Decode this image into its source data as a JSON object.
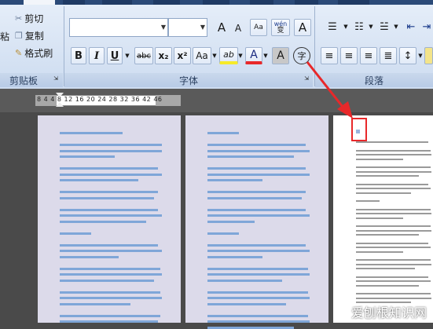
{
  "clipboard": {
    "cut": "剪切",
    "copy": "复制",
    "format_painter": "格式刷",
    "paste_partial": "粘",
    "group_label": "剪贴板"
  },
  "font": {
    "group_label": "字体",
    "grow": "A",
    "shrink": "A",
    "clear": "Aa",
    "wen": "wén",
    "wen_sub": "变",
    "box_a": "A",
    "bold": "B",
    "italic": "I",
    "underline": "U",
    "strike": "abc",
    "subscript": "x₂",
    "superscript": "x²",
    "case": "Aa",
    "highlight": "ab",
    "font_color": "A",
    "char_shade": "A",
    "enclose": "字"
  },
  "paragraph": {
    "group_label": "段落"
  },
  "ruler": {
    "text": "8 4   4 8 12 16 20 24 28 32 36   42 46"
  },
  "watermark": "爱刨根知识网",
  "colors": {
    "accent_red": "#e8282a",
    "selection": "#7fa6d8",
    "ribbon": "#dfe8f5"
  }
}
